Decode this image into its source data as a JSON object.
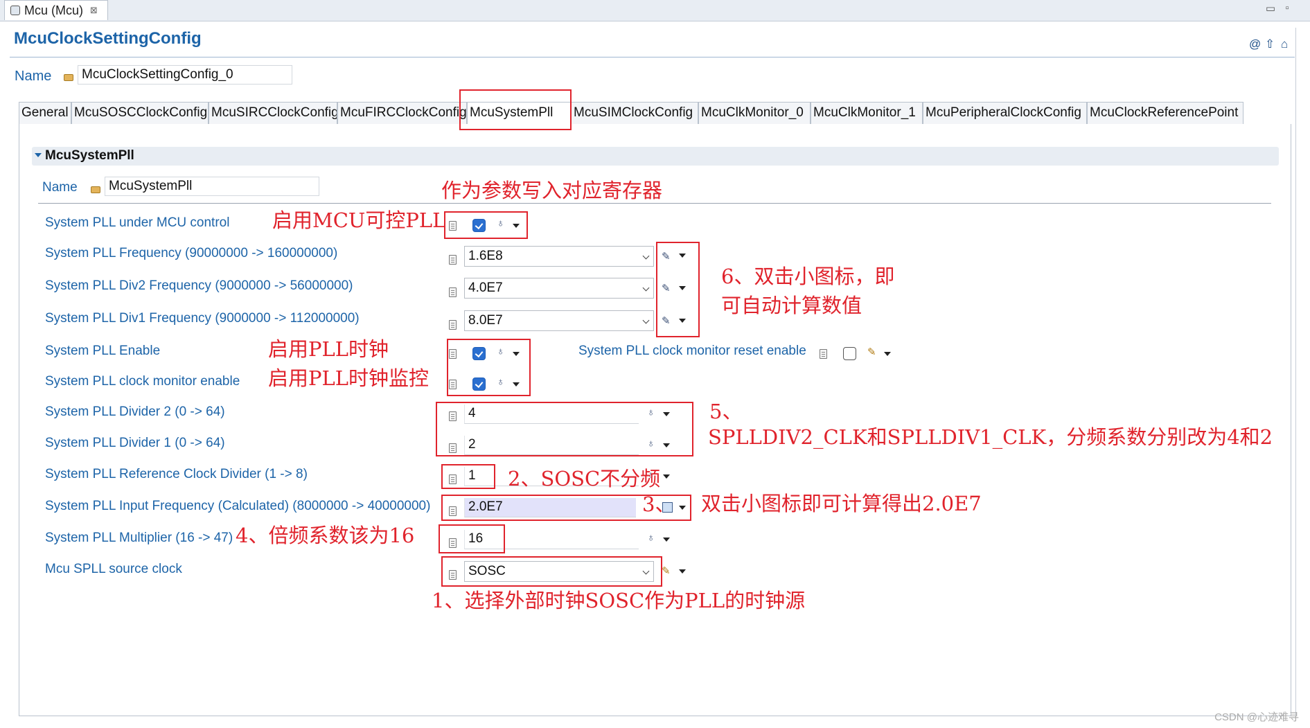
{
  "editor_tab": {
    "title": "Mcu (Mcu)",
    "close": "⊠"
  },
  "window_controls": {
    "minimize": "▭",
    "maximize": "▫"
  },
  "page_title": "McuClockSettingConfig",
  "toolbar_icons": {
    "help": "@",
    "up": "⇧",
    "home": "⌂"
  },
  "top_name": {
    "label": "Name",
    "value": "McuClockSettingConfig_0"
  },
  "tabs": [
    {
      "label": "General"
    },
    {
      "label": "McuSOSCClockConfig"
    },
    {
      "label": "McuSIRCClockConfig"
    },
    {
      "label": "McuFIRCClockConfig"
    },
    {
      "label": "McuSystemPll"
    },
    {
      "label": "McuSIMClockConfig"
    },
    {
      "label": "McuClkMonitor_0"
    },
    {
      "label": "McuClkMonitor_1"
    },
    {
      "label": "McuPeripheralClockConfig"
    },
    {
      "label": "McuClockReferencePoint"
    }
  ],
  "active_tab": "McuSystemPll",
  "section": {
    "title": "McuSystemPll",
    "name_label": "Name",
    "name_value": "McuSystemPll"
  },
  "params": {
    "under_mcu_control": {
      "label": "System PLL under MCU control",
      "checked": true
    },
    "pll_freq": {
      "label": "System PLL Frequency (90000000 -> 160000000)",
      "value": "1.6E8"
    },
    "div2_freq": {
      "label": "System PLL Div2 Frequency (9000000 -> 56000000)",
      "value": "4.0E7"
    },
    "div1_freq": {
      "label": "System PLL Div1 Frequency (9000000 -> 112000000)",
      "value": "8.0E7"
    },
    "enable": {
      "label": "System PLL Enable",
      "checked": true
    },
    "monitor_reset": {
      "label": "System PLL clock monitor reset enable",
      "checked": false
    },
    "monitor_enable": {
      "label": "System PLL clock monitor enable",
      "checked": true
    },
    "divider2": {
      "label": "System PLL Divider 2 (0 -> 64)",
      "value": "4"
    },
    "divider1": {
      "label": "System PLL Divider 1 (0 -> 64)",
      "value": "2"
    },
    "ref_divider": {
      "label": "System PLL Reference Clock Divider (1 -> 8)",
      "value": "1"
    },
    "input_freq": {
      "label": "System PLL Input Frequency (Calculated) (8000000 -> 40000000)",
      "value": "2.0E7"
    },
    "multiplier": {
      "label": "System PLL Multiplier (16 -> 47)",
      "value": "16"
    },
    "source_clock": {
      "label": "Mcu SPLL source clock",
      "value": "SOSC"
    }
  },
  "annotations": {
    "write_register": "作为参数写入对应寄存器",
    "enable_mcu_pll": "启用MCU可控PLL",
    "step6_line1": "6、双击小图标，即",
    "step6_line2": "可自动计算数值",
    "enable_pll_clock": "启用PLL时钟",
    "enable_pll_monitor": "启用PLL时钟监控",
    "step5_line1": "5、",
    "step5_line2": "SPLLDIV2_CLK和SPLLDIV1_CLK，分频系数分别改为4和2",
    "step2": "2、SOSC不分频",
    "step3_num": "3、",
    "step3_text": "双击小图标即可计算得出2.0E7",
    "step4": "4、倍频系数该为16",
    "step1": "1、选择外部时钟SOSC作为PLL的时钟源"
  },
  "watermark": "CSDN @心迹难寻",
  "colors": {
    "label_blue": "#1d64a8",
    "annotation_red": "#e0232c",
    "checkbox_blue": "#2a6fd0",
    "highlight_field": "#e2e2fa"
  }
}
